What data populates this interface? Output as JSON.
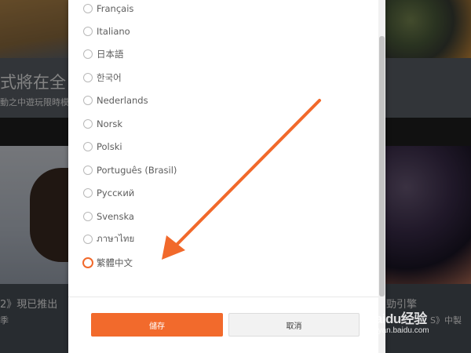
{
  "background": {
    "top_left_title": "式將在全",
    "top_left_subtitle": "動之中遊玩限時模",
    "bottom_left_title": "2》現已推出",
    "bottom_left_subtitle": "季",
    "bottom_right_title": "勁引擎",
    "bottom_right_subtitle": "S》中製"
  },
  "language_dialog": {
    "languages": [
      {
        "label": "Français",
        "selected": false
      },
      {
        "label": "Italiano",
        "selected": false
      },
      {
        "label": "日本語",
        "selected": false
      },
      {
        "label": "한국어",
        "selected": false
      },
      {
        "label": "Nederlands",
        "selected": false
      },
      {
        "label": "Norsk",
        "selected": false
      },
      {
        "label": "Polski",
        "selected": false
      },
      {
        "label": "Português (Brasil)",
        "selected": false
      },
      {
        "label": "Русский",
        "selected": false
      },
      {
        "label": "Svenska",
        "selected": false
      },
      {
        "label": "ภาษาไทย",
        "selected": false
      },
      {
        "label": "繁體中文",
        "selected": true
      }
    ],
    "save_label": "儲存",
    "cancel_label": "取消"
  },
  "annotation": {
    "arrow_color": "#f1692b"
  },
  "watermark": {
    "brand": "Baidu经验",
    "url": "jingyan.baidu.com"
  },
  "colors": {
    "accent": "#f26a2c",
    "radio_selected": "#f1692b"
  }
}
